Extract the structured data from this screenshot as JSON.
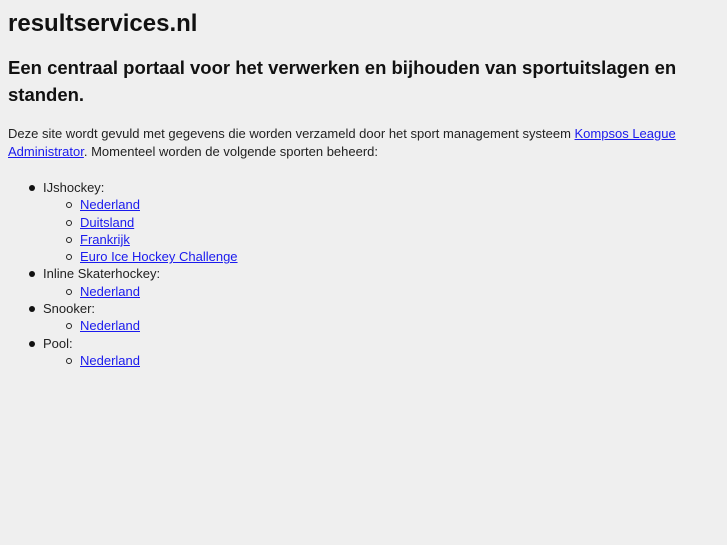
{
  "header": {
    "site_title": "resultservices.nl",
    "tagline": "Een centraal portaal voor het verwerken en bijhouden van sportuitslagen en standen."
  },
  "intro": {
    "text_before_link": "Deze site wordt gevuld met gegevens die worden verzameld door het sport management systeem ",
    "link_label": "Kompsos League Administrator",
    "text_after_link": ". Momenteel worden de volgende sporten beheerd:"
  },
  "sports": [
    {
      "name": "IJshockey:",
      "countries": [
        "Nederland",
        "Duitsland",
        "Frankrijk",
        "Euro Ice Hockey Challenge"
      ]
    },
    {
      "name": "Inline Skaterhockey:",
      "countries": [
        "Nederland"
      ]
    },
    {
      "name": "Snooker:",
      "countries": [
        "Nederland"
      ]
    },
    {
      "name": "Pool:",
      "countries": [
        "Nederland"
      ]
    }
  ],
  "colors": {
    "background": "#efefef",
    "link": "#1a1aee",
    "text": "#111111"
  }
}
